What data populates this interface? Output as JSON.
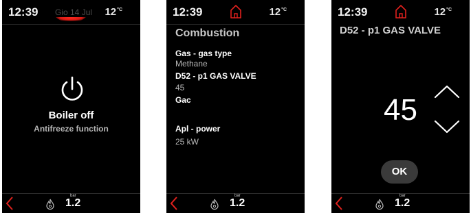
{
  "colors": {
    "accent": "#e0211d",
    "background": "#000000",
    "muted": "#b4b4b4"
  },
  "screen1": {
    "status": {
      "time": "12:39",
      "date": "Gio 14 Jul",
      "temperature": "12",
      "temperature_unit": "°C"
    },
    "title": "Boiler off",
    "subtitle": "Antifreeze function",
    "icon": "power-icon",
    "bottom": {
      "pressure_unit": "bar",
      "pressure_value": "1.2"
    }
  },
  "screen2": {
    "status": {
      "time": "12:39",
      "temperature": "12",
      "temperature_unit": "°C"
    },
    "title": "Combustion",
    "items": [
      {
        "label": "Gas - gas type",
        "value": "Methane"
      },
      {
        "label": "D52 - p1 GAS VALVE",
        "value": "45"
      },
      {
        "label": "Gac",
        "value": ""
      },
      {
        "label": "Apl - power",
        "value": "25 kW"
      }
    ],
    "bottom": {
      "pressure_unit": "bar",
      "pressure_value": "1.2"
    }
  },
  "screen3": {
    "status": {
      "time": "12:39",
      "temperature": "12",
      "temperature_unit": "°C"
    },
    "title": "D52 - p1 GAS VALVE",
    "value": "45",
    "ok_label": "OK",
    "bottom": {
      "pressure_unit": "bar",
      "pressure_value": "1.2"
    }
  }
}
